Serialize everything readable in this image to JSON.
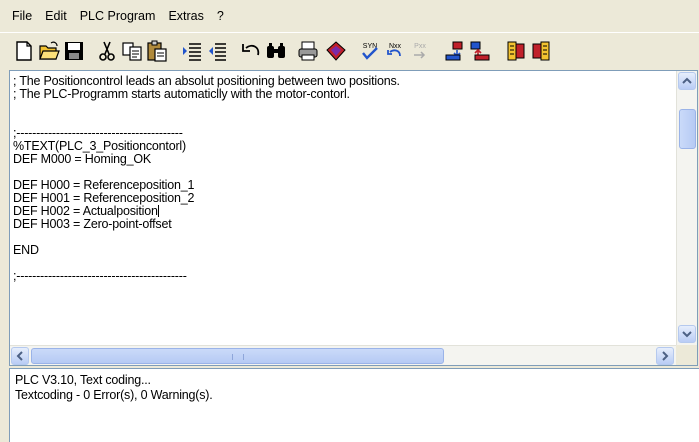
{
  "menu": [
    "File",
    "Edit",
    "PLC Program",
    "Extras",
    "?"
  ],
  "toolbar": [
    {
      "icon": "new-file-icon"
    },
    {
      "icon": "open-folder-icon"
    },
    {
      "icon": "save-icon"
    },
    {
      "icon": "cut-icon"
    },
    {
      "icon": "copy-icon"
    },
    {
      "icon": "paste-icon"
    },
    {
      "icon": "indent-icon"
    },
    {
      "icon": "outdent-icon"
    },
    {
      "icon": "undo-icon"
    },
    {
      "icon": "find-icon"
    },
    {
      "icon": "print-icon"
    },
    {
      "icon": "compile-icon"
    },
    {
      "icon": "syntax-check-icon",
      "text": "SYN"
    },
    {
      "icon": "next-error-icon",
      "text": "Nxx"
    },
    {
      "icon": "previous-error-icon",
      "text": "Pxx"
    },
    {
      "icon": "download-to-drive-icon"
    },
    {
      "icon": "upload-from-drive-icon"
    },
    {
      "icon": "start-plc-icon"
    },
    {
      "icon": "stop-plc-icon"
    }
  ],
  "editor": {
    "lines": [
      "; The Positioncontrol leads an absolut positioning between two positions.",
      "; The PLC-Programm starts automaticlly with the motor-contorl.",
      "",
      "",
      ";------------------------------------------",
      "%TEXT(PLC_3_Positioncontorl)",
      "DEF M000 = Homing_OK",
      "",
      "DEF H000 = Referenceposition_1",
      "DEF H001 = Referenceposition_2",
      "DEF H002 = Actualposition",
      "DEF H003 = Zero-point-offset",
      "",
      "END",
      "",
      ";-------------------------------------------"
    ]
  },
  "output": {
    "lines": [
      "PLC V3.10, Text coding...",
      "Textcoding - 0 Error(s), 0 Warning(s)."
    ]
  },
  "colors": {
    "accent": "#316AC5",
    "scrollbar": "#B6CAF4",
    "red": "#C0202A",
    "yellow": "#F2C230"
  }
}
